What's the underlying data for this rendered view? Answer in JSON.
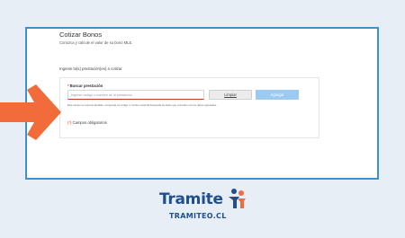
{
  "page": {
    "title": "Cotizar Bonos",
    "subtitle": "Conozca y calcule el valor de su bono MLE.",
    "section_label": "Ingrese la(s) prestación(es) a cotizar"
  },
  "form": {
    "field_required_mark": "*",
    "field_label": "Buscar prestación",
    "search_placeholder": "Ingrese código o nombre de la prestación",
    "clear_button": "Limpiar",
    "add_button": "Agregar",
    "hint_text": "Este campo es autocompletable, al ingresar su código o nombre nacional búsqueda de datos que coinciden con los datos ingresados.",
    "required_note_mark": "(*)",
    "required_note_text": "Campos obligatorios"
  },
  "brand": {
    "name": "Tramite",
    "domain": "TRAMITEO.CL"
  },
  "colors": {
    "background": "#e7eef6",
    "frame_border": "#3e92cc",
    "arrow": "#f26b3a",
    "primary_button": "#9ccaf0",
    "brand_blue": "#1d4f91",
    "brand_orange": "#f26b3a",
    "required": "#d33"
  },
  "icons": {
    "arrow": "right-arrow-icon",
    "brand_mark": "people-logo-icon"
  }
}
